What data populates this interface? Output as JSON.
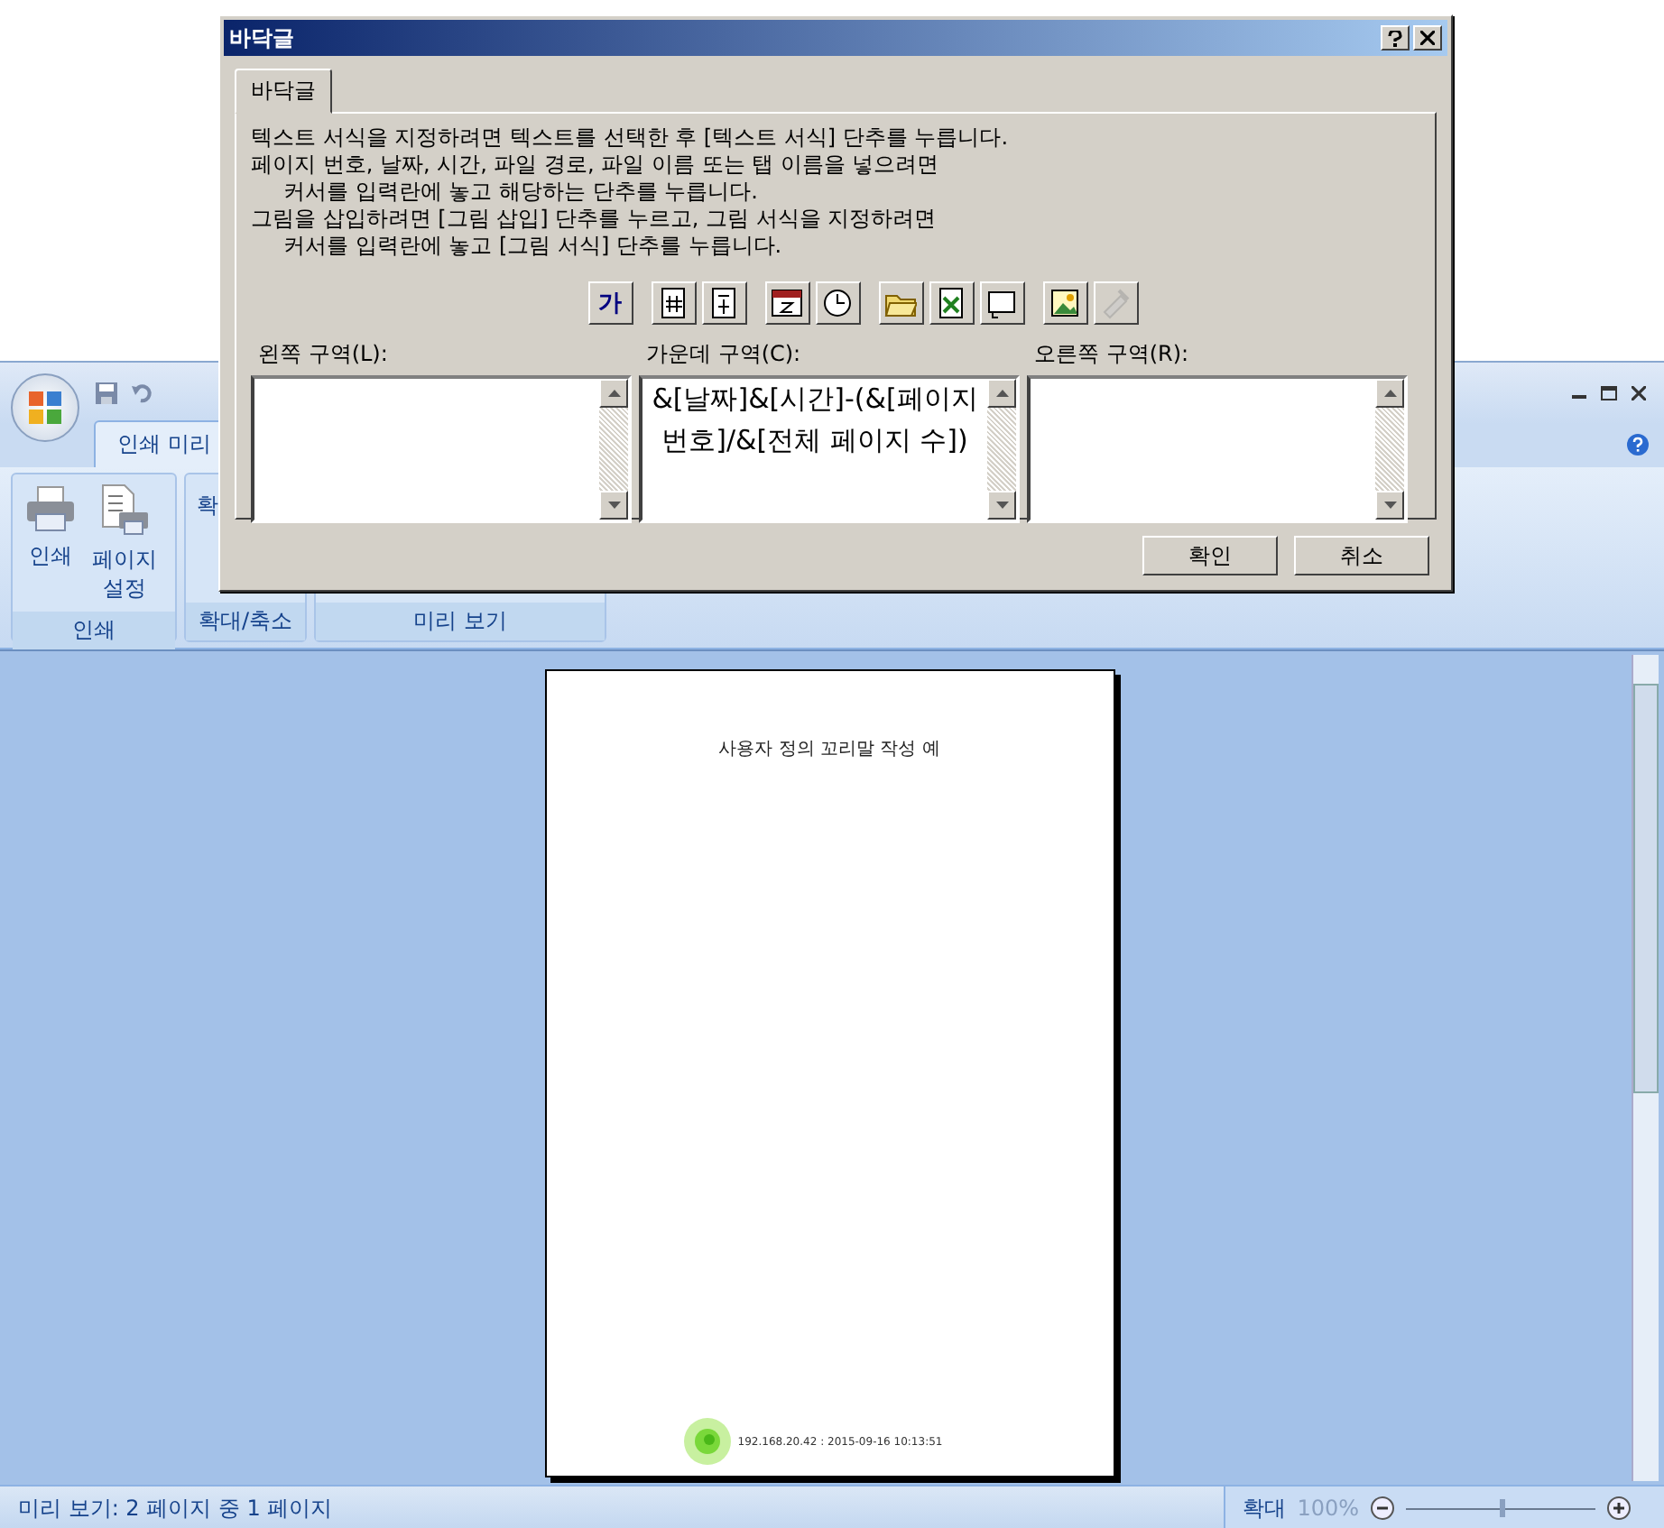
{
  "app": {
    "tabs": [
      {
        "label": "인쇄 미리",
        "selected": true
      }
    ],
    "ribbon_groups": [
      {
        "label": "인쇄",
        "buttons": [
          {
            "label": "인쇄",
            "kind": "print"
          },
          {
            "label": "페이지\n설정",
            "kind": "page_setup"
          }
        ]
      },
      {
        "label": "확대/축소",
        "buttons": [
          {
            "label": "확",
            "kind": "zoom"
          }
        ]
      },
      {
        "label": "미리 보기"
      }
    ]
  },
  "page": {
    "title": "사용자 정의 꼬리말 작성 예",
    "footer": "192.168.20.42 : 2015-09-16 10:13:51"
  },
  "status_bar": {
    "page_info": "미리 보기: 2 페이지 중 1 페이지",
    "zoom_label": "확대",
    "zoom_percent": "100%",
    "zoom": {
      "level": 0.5
    }
  },
  "dialog": {
    "title": "바닥글",
    "tabs": [
      {
        "label": "바닥글",
        "selected": true
      }
    ],
    "instructions": [
      {
        "text": "텍스트 서식을 지정하려면 텍스트를 선택한 후 [텍스트 서식] 단추를 누릅니다.",
        "kind": "line"
      },
      {
        "text": "페이지 번호, 날짜, 시간, 파일 경로, 파일 이름 또는 탭 이름을 넣으려면",
        "kind": "line"
      },
      {
        "text": "커서를 입력란에 놓고 해당하는 단추를 누릅니다.",
        "kind": "continuation"
      },
      {
        "text": "그림을 삽입하려면 [그림 삽입] 단추를 누르고, 그림 서식을 지정하려면",
        "kind": "line"
      },
      {
        "text": "커서를 입력란에 놓고 [그림 서식] 단추를 누릅니다.",
        "kind": "continuation"
      }
    ],
    "toolbar": [
      [
        {
          "kind": "text_format",
          "glyph": "가"
        }
      ],
      [
        {
          "kind": "page_number"
        },
        {
          "kind": "page_count"
        }
      ],
      [
        {
          "kind": "date"
        },
        {
          "kind": "time"
        }
      ],
      [
        {
          "kind": "file_path"
        },
        {
          "kind": "file_name"
        },
        {
          "kind": "sheet_name"
        }
      ],
      [
        {
          "kind": "insert_picture"
        },
        {
          "kind": "format_picture",
          "disabled": true
        }
      ]
    ],
    "sections": [
      {
        "label": "왼쪽 구역(L):"
      },
      {
        "label": "가운데 구역(C):",
        "value": "&[날짜]&[시간]-(&[페이지 번호]/&[전체 페이지 수])"
      },
      {
        "label": "오른쪽 구역(R):"
      }
    ],
    "buttons": [
      "확인",
      "취소"
    ]
  }
}
